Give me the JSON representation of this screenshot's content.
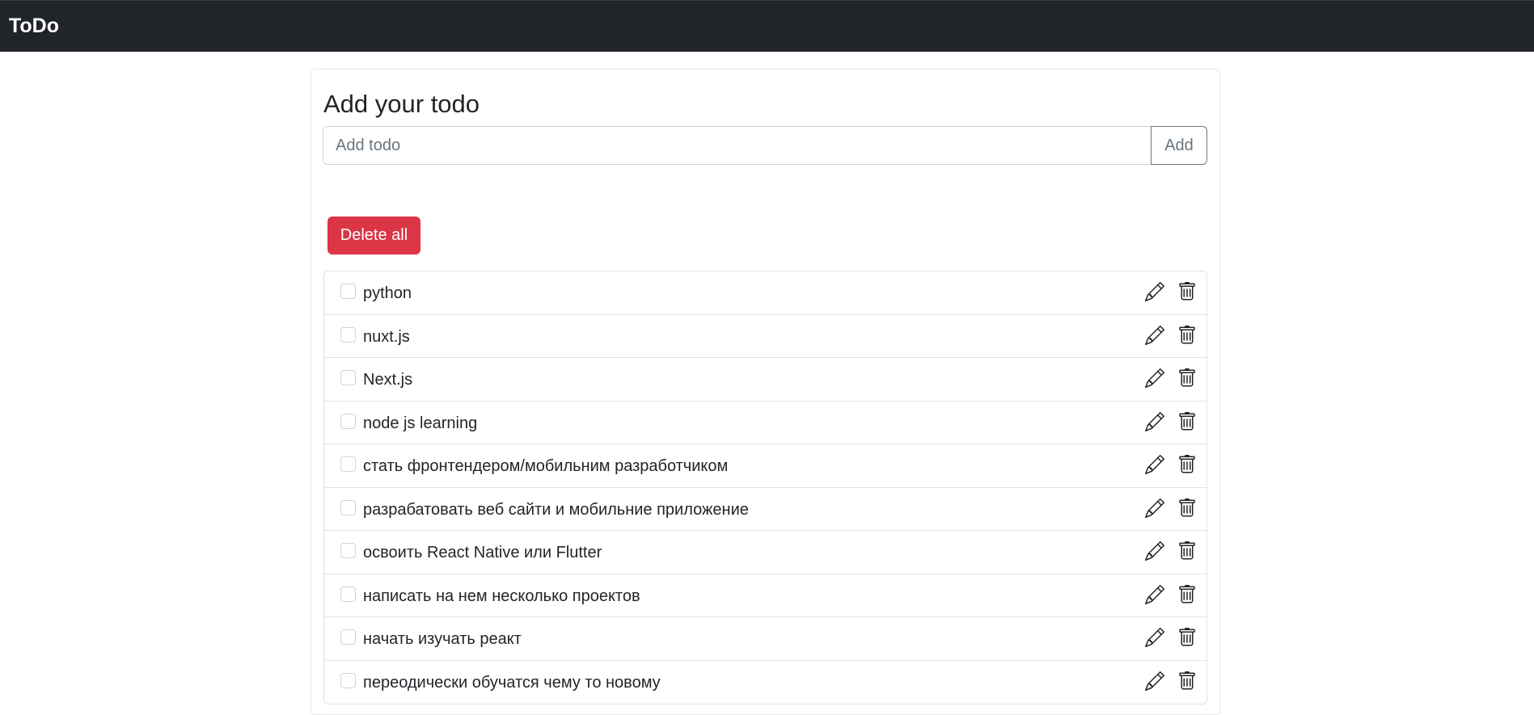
{
  "navbar": {
    "brand": "ToDo"
  },
  "form": {
    "title": "Add your todo",
    "input_placeholder": "Add todo",
    "input_value": "",
    "add_label": "Add"
  },
  "actions": {
    "delete_all_label": "Delete all"
  },
  "todos": [
    {
      "text": "python",
      "done": false
    },
    {
      "text": "nuxt.js",
      "done": false
    },
    {
      "text": "Next.js",
      "done": false
    },
    {
      "text": "node js learning",
      "done": false
    },
    {
      "text": "стать фронтендером/мобильним разработчиком",
      "done": false
    },
    {
      "text": "разрабатовать веб сайти и мобильние приложение",
      "done": false
    },
    {
      "text": "освоить React Native или Flutter",
      "done": false
    },
    {
      "text": "написать на нем несколько проектов",
      "done": false
    },
    {
      "text": "начать изучать реакт",
      "done": false
    },
    {
      "text": "переодически обучатся чему то новому",
      "done": false
    }
  ],
  "icons": {
    "edit": "pencil-icon",
    "delete": "trash-icon"
  },
  "colors": {
    "navbar": "#212529",
    "danger": "#dc3545",
    "secondary": "#6c757d",
    "border": "#dee2e6"
  }
}
